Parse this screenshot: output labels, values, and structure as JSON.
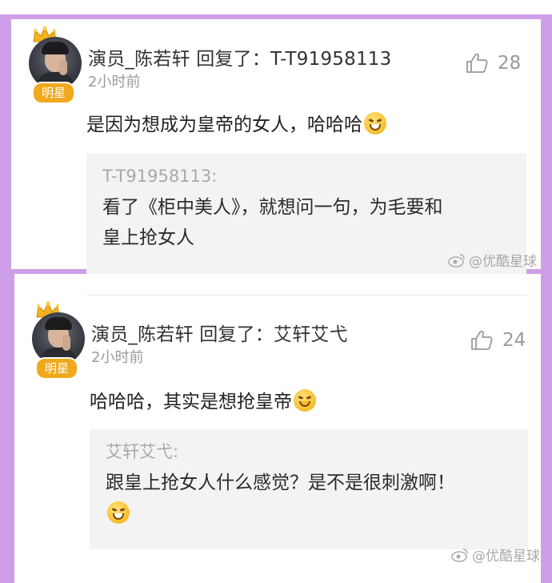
{
  "comments": [
    {
      "username": "演员_陈若轩 回复了：T-T91958113",
      "badge": "明星",
      "time": "2小时前",
      "likes": "28",
      "text": "是因为想成为皇帝的女人，哈哈哈",
      "quote_author": "T-T91958113:",
      "quote_line1": "看了《柜中美人》，就想问一句，为毛要和",
      "quote_line2": "皇上抢女人"
    },
    {
      "username": "演员_陈若轩 回复了：艾轩艾弋",
      "badge": "明星",
      "time": "2小时前",
      "likes": "24",
      "text": "哈哈哈，其实是想抢皇帝",
      "quote_author": "艾轩艾弋:",
      "quote_line1": "跟皇上抢女人什么感觉？是不是很刺激啊！"
    }
  ],
  "watermark": "@优酷星球",
  "colors": {
    "frame_purple": "#cf9ee8",
    "badge_orange": "#f0a81c"
  },
  "icons": [
    "crown-icon",
    "thumbs-up-icon",
    "grinning-emoji-icon",
    "smile-emoji-icon",
    "weibo-logo-icon"
  ]
}
